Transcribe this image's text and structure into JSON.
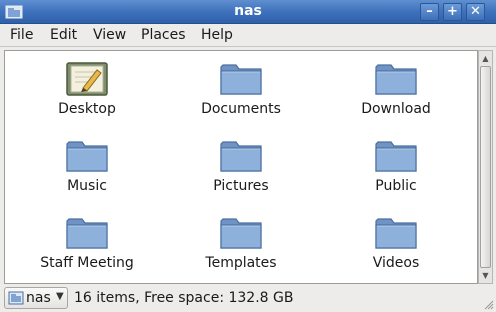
{
  "window": {
    "title": "nas",
    "min_glyph": "–",
    "max_glyph": "+",
    "close_glyph": "✕"
  },
  "menu": {
    "items": [
      {
        "label": "File"
      },
      {
        "label": "Edit"
      },
      {
        "label": "View"
      },
      {
        "label": "Places"
      },
      {
        "label": "Help"
      }
    ]
  },
  "files": {
    "items": [
      {
        "label": "Desktop",
        "icon": "desktop-icon"
      },
      {
        "label": "Documents",
        "icon": "folder-icon"
      },
      {
        "label": "Download",
        "icon": "folder-icon"
      },
      {
        "label": "Music",
        "icon": "folder-icon"
      },
      {
        "label": "Pictures",
        "icon": "folder-icon"
      },
      {
        "label": "Public",
        "icon": "folder-icon"
      },
      {
        "label": "Staff Meeting",
        "icon": "folder-icon"
      },
      {
        "label": "Templates",
        "icon": "folder-icon"
      },
      {
        "label": "Videos",
        "icon": "folder-icon"
      }
    ]
  },
  "status": {
    "location": "nas",
    "text": "16 items, Free space: 132.8 GB"
  },
  "colors": {
    "titlebar": "#3f72bc",
    "folder_fill": "#8eb1dc",
    "folder_stroke": "#4a6f9f"
  }
}
